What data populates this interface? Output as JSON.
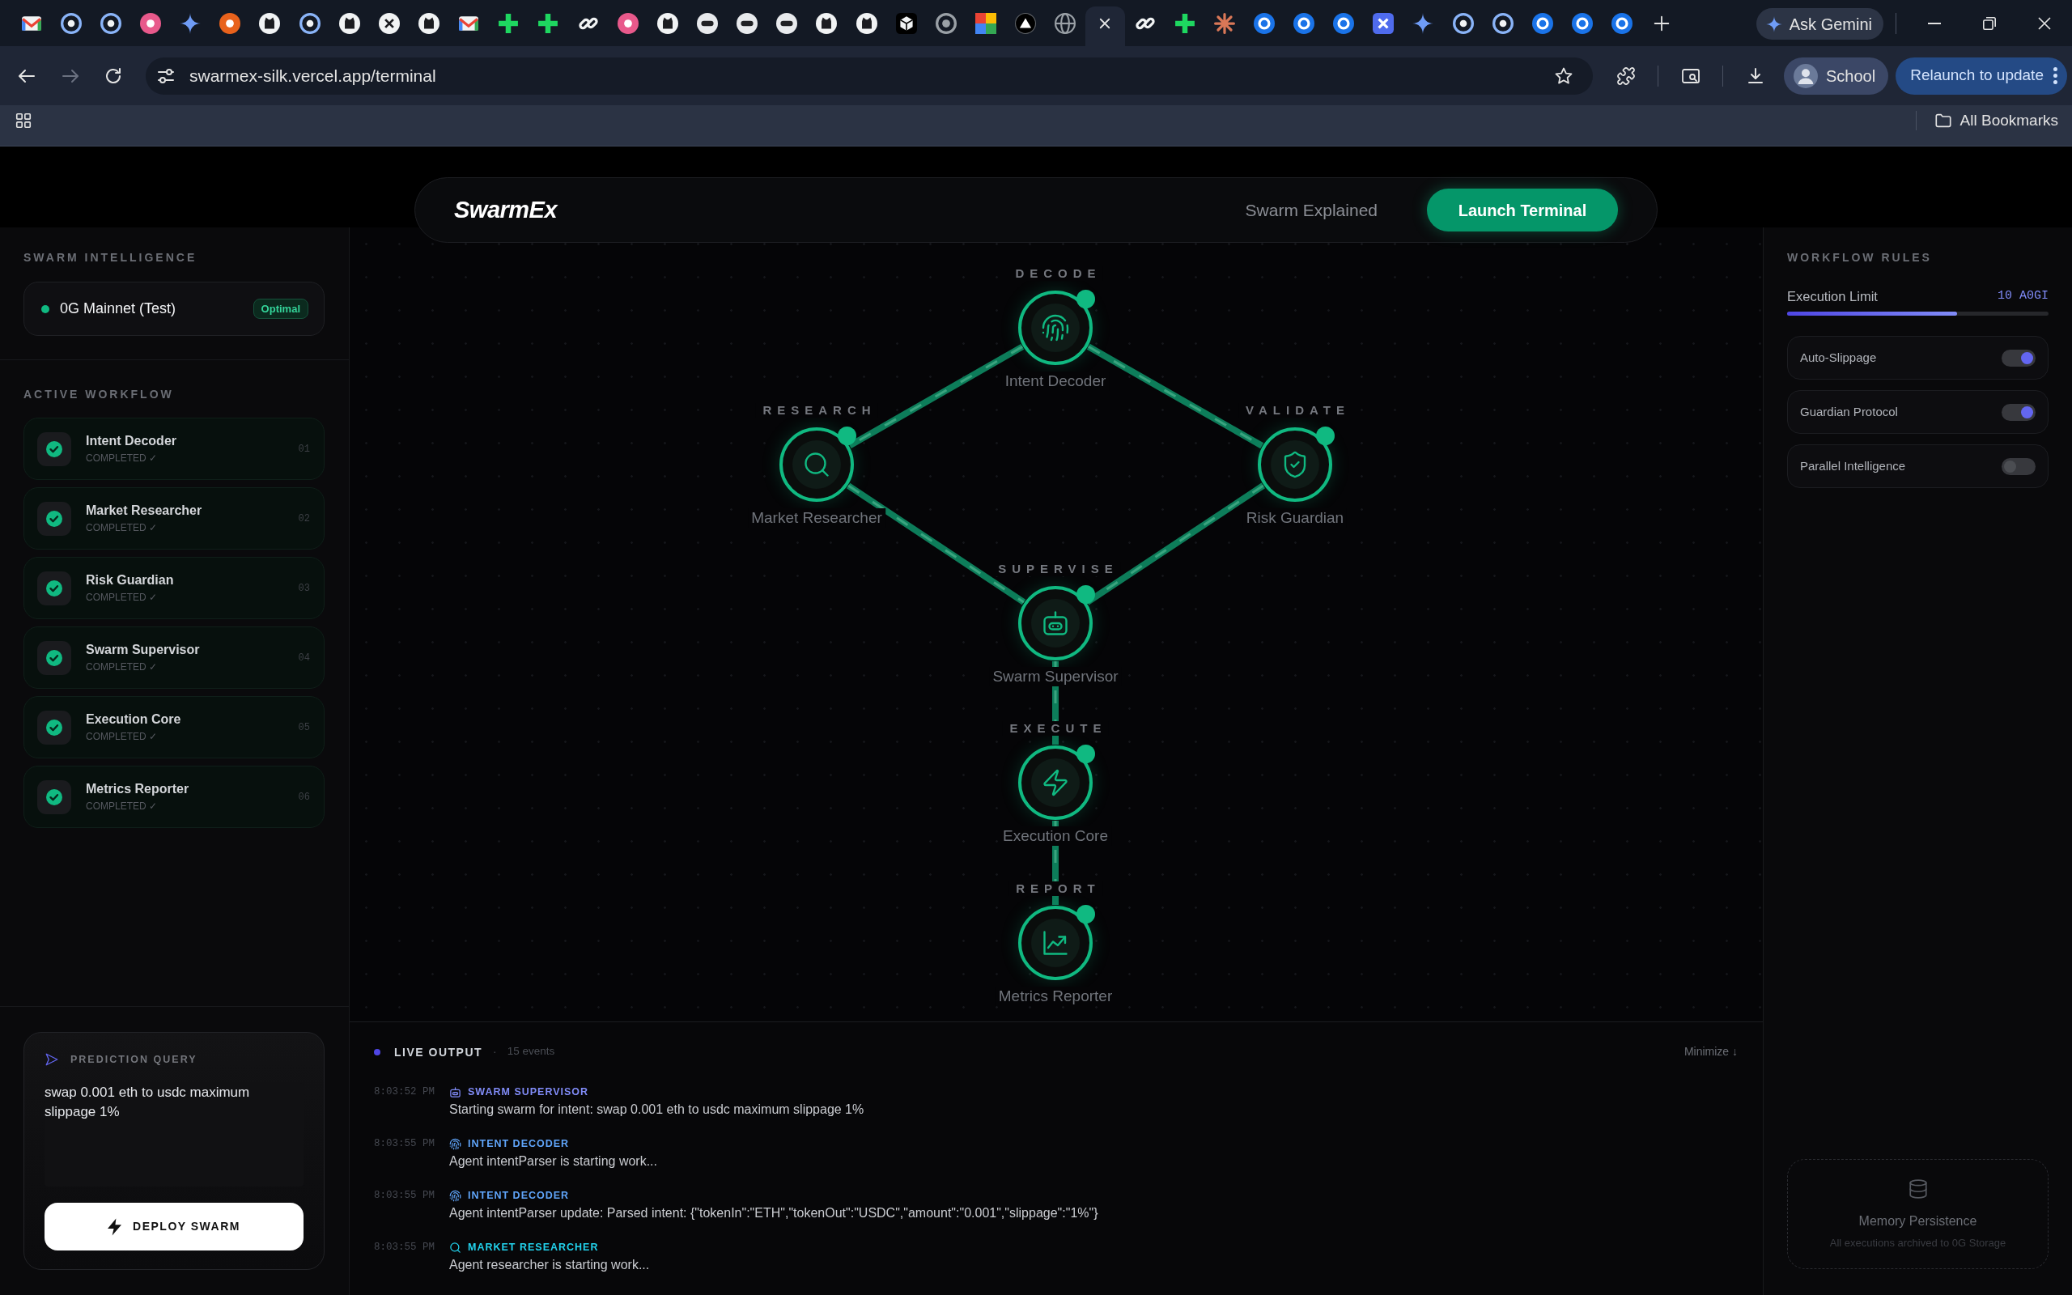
{
  "browser": {
    "tabs": [
      {
        "selected": false
      },
      {
        "selected": false
      },
      {
        "selected": false
      },
      {
        "selected": false
      },
      {
        "selected": false
      },
      {
        "selected": false
      },
      {
        "selected": false
      },
      {
        "selected": false
      },
      {
        "selected": false
      },
      {
        "selected": false
      },
      {
        "selected": false
      },
      {
        "selected": false
      },
      {
        "selected": false
      },
      {
        "selected": false
      },
      {
        "selected": false
      },
      {
        "selected": false
      },
      {
        "selected": false
      },
      {
        "selected": false
      },
      {
        "selected": false
      },
      {
        "selected": false
      },
      {
        "selected": false
      },
      {
        "selected": false
      },
      {
        "selected": false
      },
      {
        "selected": false
      },
      {
        "selected": false
      },
      {
        "selected": false
      },
      {
        "selected": false
      },
      {
        "selected": true
      },
      {
        "selected": false
      },
      {
        "selected": false
      },
      {
        "selected": false
      },
      {
        "selected": false
      },
      {
        "selected": false
      },
      {
        "selected": false
      },
      {
        "selected": false
      },
      {
        "selected": false
      },
      {
        "selected": false
      },
      {
        "selected": false
      },
      {
        "selected": false
      },
      {
        "selected": false
      },
      {
        "selected": false
      }
    ],
    "ask_button": "Ask Gemini",
    "nav_buttons": [
      {
        "kind": "back",
        "disabled": false
      },
      {
        "kind": "forward",
        "disabled": true
      },
      {
        "kind": "reload",
        "disabled": false
      }
    ],
    "address": "swarmex-silk.vercel.app/terminal",
    "profile": "School",
    "update_button": "Relaunch to update",
    "bookmarks_folder": "All Bookmarks"
  },
  "header": {
    "logo": "SwarmEx",
    "links": [
      {
        "kind": "link",
        "label": "Swarm Explained"
      },
      {
        "kind": "primary",
        "label": "Launch Terminal"
      }
    ]
  },
  "left_sidebar": {
    "title": "SWARM INTELLIGENCE",
    "network": {
      "name": "0G Mainnet (Test)",
      "status": "Optimal"
    },
    "workflow_title": "ACTIVE WORKFLOW",
    "workflow": [
      {
        "name": "Intent Decoder",
        "status": "COMPLETED ✓",
        "number": "01",
        "completed": true
      },
      {
        "name": "Market Researcher",
        "status": "COMPLETED ✓",
        "number": "02",
        "completed": true
      },
      {
        "name": "Risk Guardian",
        "status": "COMPLETED ✓",
        "number": "03",
        "completed": true
      },
      {
        "name": "Swarm Supervisor",
        "status": "COMPLETED ✓",
        "number": "04",
        "completed": true
      },
      {
        "name": "Execution Core",
        "status": "COMPLETED ✓",
        "number": "05",
        "completed": true
      },
      {
        "name": "Metrics Reporter",
        "status": "COMPLETED ✓",
        "number": "06",
        "completed": true
      }
    ],
    "query": {
      "title": "PREDICTION QUERY",
      "value": "swap 0.001 eth to usdc maximum slippage 1%",
      "button": "DEPLOY SWARM"
    }
  },
  "diagram": {
    "nodes": [
      {
        "stage": "DECODE",
        "name": "Intent Decoder",
        "kind": "decoder",
        "completed": true
      },
      {
        "stage": "RESEARCH",
        "name": "Market Researcher",
        "kind": "researcher",
        "completed": true
      },
      {
        "stage": "VALIDATE",
        "name": "Risk Guardian",
        "kind": "guardian",
        "completed": true
      },
      {
        "stage": "SUPERVISE",
        "name": "Swarm Supervisor",
        "kind": "supervisor",
        "completed": true
      },
      {
        "stage": "EXECUTE",
        "name": "Execution Core",
        "kind": "executor",
        "completed": true
      },
      {
        "stage": "REPORT",
        "name": "Metrics Reporter",
        "kind": "reporter",
        "completed": true
      }
    ]
  },
  "live_output": {
    "title": "LIVE OUTPUT",
    "separator": "·",
    "count": "15 events",
    "minimize": "Minimize ↓",
    "entries": [
      {
        "time": "8:03:52 PM",
        "agent": "SWARM SUPERVISOR",
        "kind": "supervisor",
        "color": "#818cf8",
        "message": "Starting swarm for intent: swap 0.001 eth to usdc maximum slippage 1%"
      },
      {
        "time": "8:03:55 PM",
        "agent": "INTENT DECODER",
        "kind": "decoder",
        "color": "#60a5fa",
        "message": "Agent intentParser is starting work..."
      },
      {
        "time": "8:03:55 PM",
        "agent": "INTENT DECODER",
        "kind": "decoder",
        "color": "#60a5fa",
        "message": "Agent intentParser update: Parsed intent: {\"tokenIn\":\"ETH\",\"tokenOut\":\"USDC\",\"amount\":\"0.001\",\"slippage\":\"1%\"}"
      },
      {
        "time": "8:03:55 PM",
        "agent": "MARKET RESEARCHER",
        "kind": "researcher",
        "color": "#22d3ee",
        "message": "Agent researcher is starting work..."
      }
    ]
  },
  "right_sidebar": {
    "title": "WORKFLOW RULES",
    "limit": {
      "label": "Execution Limit",
      "value": "10 A0GI",
      "level": 0.65
    },
    "rules": [
      {
        "label": "Auto-Slippage",
        "on": true
      },
      {
        "label": "Guardian Protocol",
        "on": true
      },
      {
        "label": "Parallel Intelligence",
        "on": false
      }
    ],
    "memory": {
      "title": "Memory Persistence",
      "text": "All executions archived to 0G Storage"
    }
  }
}
